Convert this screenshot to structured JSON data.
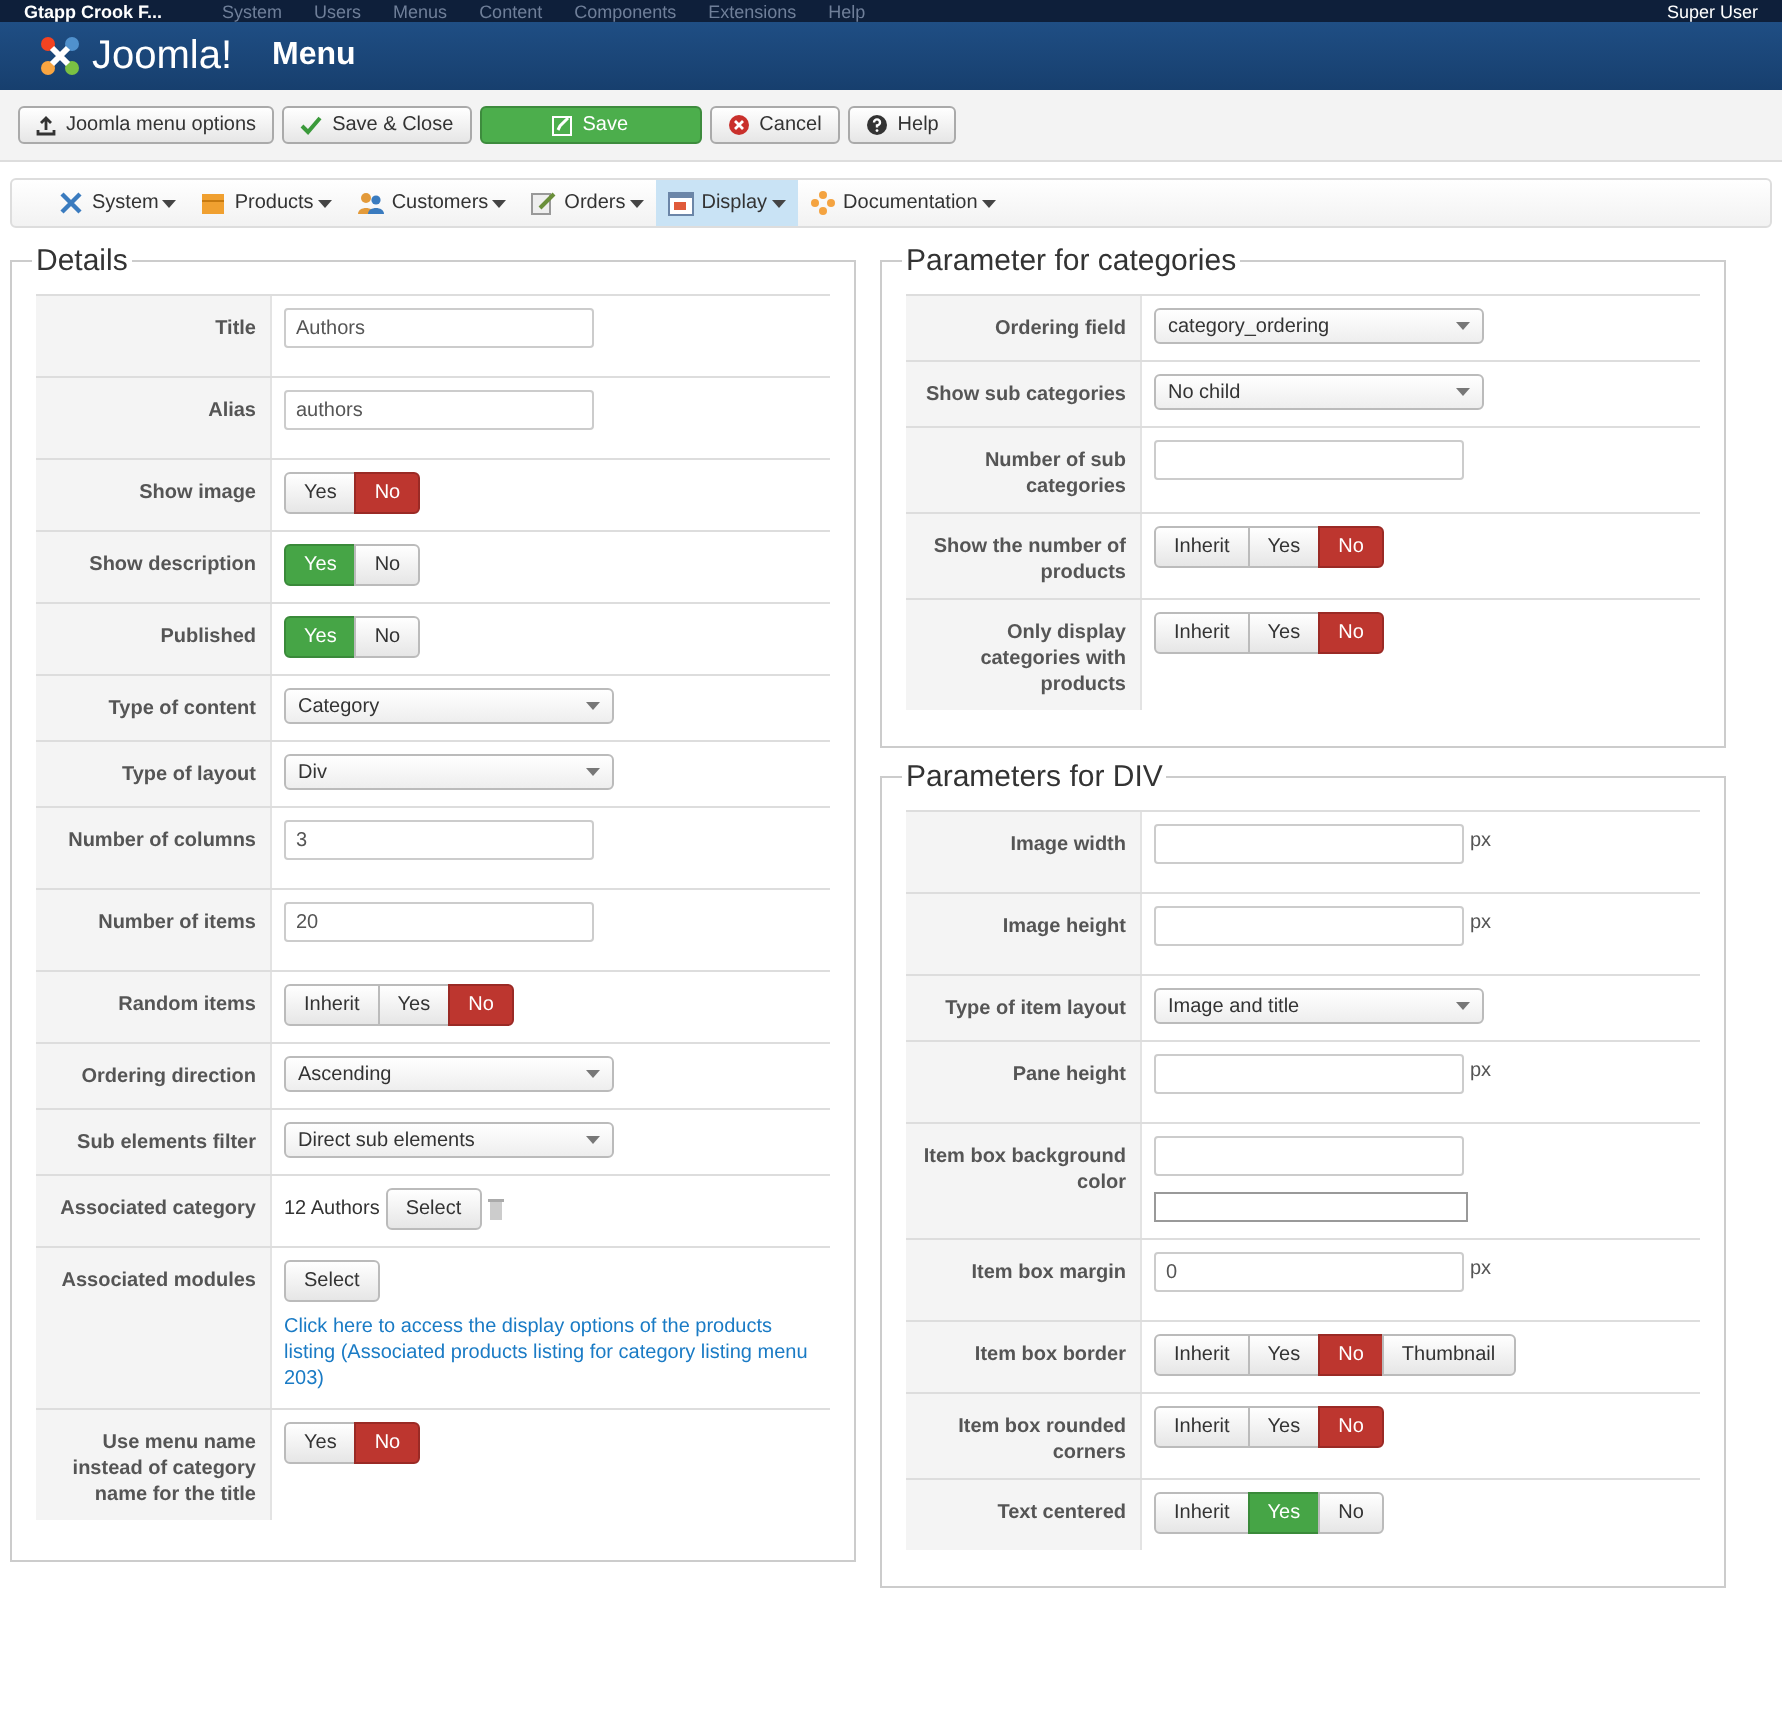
{
  "top_menu": {
    "site": "Gtapp Crook F...",
    "items": [
      "System",
      "Users",
      "Menus",
      "Content",
      "Components",
      "Extensions",
      "Help"
    ],
    "user": "Super User"
  },
  "header": {
    "logo_text": "Joomla!",
    "title": "Menu"
  },
  "toolbar": [
    {
      "label": "Joomla menu options",
      "kind": "upload"
    },
    {
      "label": "Save & Close",
      "kind": "check"
    },
    {
      "label": "Save",
      "kind": "save"
    },
    {
      "label": "Cancel",
      "kind": "cancel"
    },
    {
      "label": "Help",
      "kind": "help"
    }
  ],
  "submenu": [
    {
      "label": "System",
      "selected": false
    },
    {
      "label": "Products",
      "selected": false
    },
    {
      "label": "Customers",
      "selected": false
    },
    {
      "label": "Orders",
      "selected": false
    },
    {
      "label": "Display",
      "selected": true
    },
    {
      "label": "Documentation",
      "selected": false
    }
  ],
  "columns": [
    {
      "sections": [
        {
          "legend": "Details",
          "fields": [
            {
              "label": "Title",
              "kind": "text",
              "value": "Authors"
            },
            {
              "label": "Alias",
              "kind": "text",
              "value": "authors"
            },
            {
              "label": "Show image",
              "kind": "toggle",
              "options": [
                {
                  "label": "Yes",
                  "selected": false
                },
                {
                  "label": "No",
                  "kind": "negative",
                  "selected": true
                }
              ]
            },
            {
              "label": "Show description",
              "kind": "toggle",
              "options": [
                {
                  "label": "Yes",
                  "kind": "positive",
                  "selected": true
                },
                {
                  "label": "No",
                  "selected": false
                }
              ]
            },
            {
              "label": "Published",
              "kind": "toggle",
              "options": [
                {
                  "label": "Yes",
                  "kind": "positive",
                  "selected": true
                },
                {
                  "label": "No",
                  "selected": false
                }
              ]
            },
            {
              "label": "Type of content",
              "kind": "select",
              "value": "Category"
            },
            {
              "label": "Type of layout",
              "kind": "select",
              "value": "Div"
            },
            {
              "label": "Number of columns",
              "kind": "text",
              "value": "3"
            },
            {
              "label": "Number of items",
              "kind": "text",
              "value": "20"
            },
            {
              "label": "Random items",
              "kind": "toggle",
              "options": [
                {
                  "label": "Inherit",
                  "selected": false
                },
                {
                  "label": "Yes",
                  "selected": false
                },
                {
                  "label": "No",
                  "kind": "negative",
                  "selected": true
                }
              ]
            },
            {
              "label": "Ordering direction",
              "kind": "select",
              "value": "Ascending"
            },
            {
              "label": "Sub elements filter",
              "kind": "select",
              "value": "Direct sub elements"
            },
            {
              "label": "Associated category",
              "kind": "picker",
              "value": "12 Authors",
              "button": "Select"
            },
            {
              "label": "Associated modules",
              "kind": "modules",
              "button": "Select",
              "link": "Click here to access the display options of the products listing (Associated products listing for category listing menu 203)"
            },
            {
              "label": "Use menu name instead of category name for the title",
              "kind": "toggle",
              "options": [
                {
                  "label": "Yes",
                  "selected": false
                },
                {
                  "label": "No",
                  "kind": "negative",
                  "selected": true
                }
              ]
            }
          ]
        }
      ]
    },
    {
      "sections": [
        {
          "legend": "Parameter for categories",
          "fields": [
            {
              "label": "Ordering field",
              "kind": "select",
              "value": "category_ordering"
            },
            {
              "label": "Show sub categories",
              "kind": "select",
              "value": "No child"
            },
            {
              "label": "Number of sub categories",
              "kind": "text"
            },
            {
              "label": "Show the number of products",
              "kind": "toggle",
              "options": [
                {
                  "label": "Inherit",
                  "selected": false
                },
                {
                  "label": "Yes",
                  "selected": false
                },
                {
                  "label": "No",
                  "kind": "negative",
                  "selected": true
                }
              ]
            },
            {
              "label": "Only display categories with products",
              "kind": "toggle",
              "options": [
                {
                  "label": "Inherit",
                  "selected": false
                },
                {
                  "label": "Yes",
                  "selected": false
                },
                {
                  "label": "No",
                  "kind": "negative",
                  "selected": true
                }
              ]
            }
          ]
        },
        {
          "legend": "Parameters for DIV",
          "fields": [
            {
              "label": "Image width",
              "kind": "text",
              "unit": "px"
            },
            {
              "label": "Image height",
              "kind": "text",
              "unit": "px"
            },
            {
              "label": "Type of item layout",
              "kind": "select",
              "value": "Image and title"
            },
            {
              "label": "Pane height",
              "kind": "text",
              "unit": "px"
            },
            {
              "label": "Item box background color",
              "kind": "color"
            },
            {
              "label": "Item box margin",
              "kind": "text",
              "value": "0",
              "unit": "px"
            },
            {
              "label": "Item box border",
              "kind": "toggle",
              "options": [
                {
                  "label": "Inherit",
                  "selected": false
                },
                {
                  "label": "Yes",
                  "selected": false
                },
                {
                  "label": "No",
                  "kind": "negative",
                  "selected": true
                },
                {
                  "label": "Thumbnail",
                  "selected": false
                }
              ]
            },
            {
              "label": "Item box rounded corners",
              "kind": "toggle",
              "options": [
                {
                  "label": "Inherit",
                  "selected": false
                },
                {
                  "label": "Yes",
                  "selected": false
                },
                {
                  "label": "No",
                  "kind": "negative",
                  "selected": true
                }
              ]
            },
            {
              "label": "Text centered",
              "kind": "toggle",
              "options": [
                {
                  "label": "Inherit",
                  "selected": false
                },
                {
                  "label": "Yes",
                  "kind": "positive",
                  "selected": true
                },
                {
                  "label": "No",
                  "selected": false
                }
              ]
            }
          ]
        }
      ]
    }
  ]
}
